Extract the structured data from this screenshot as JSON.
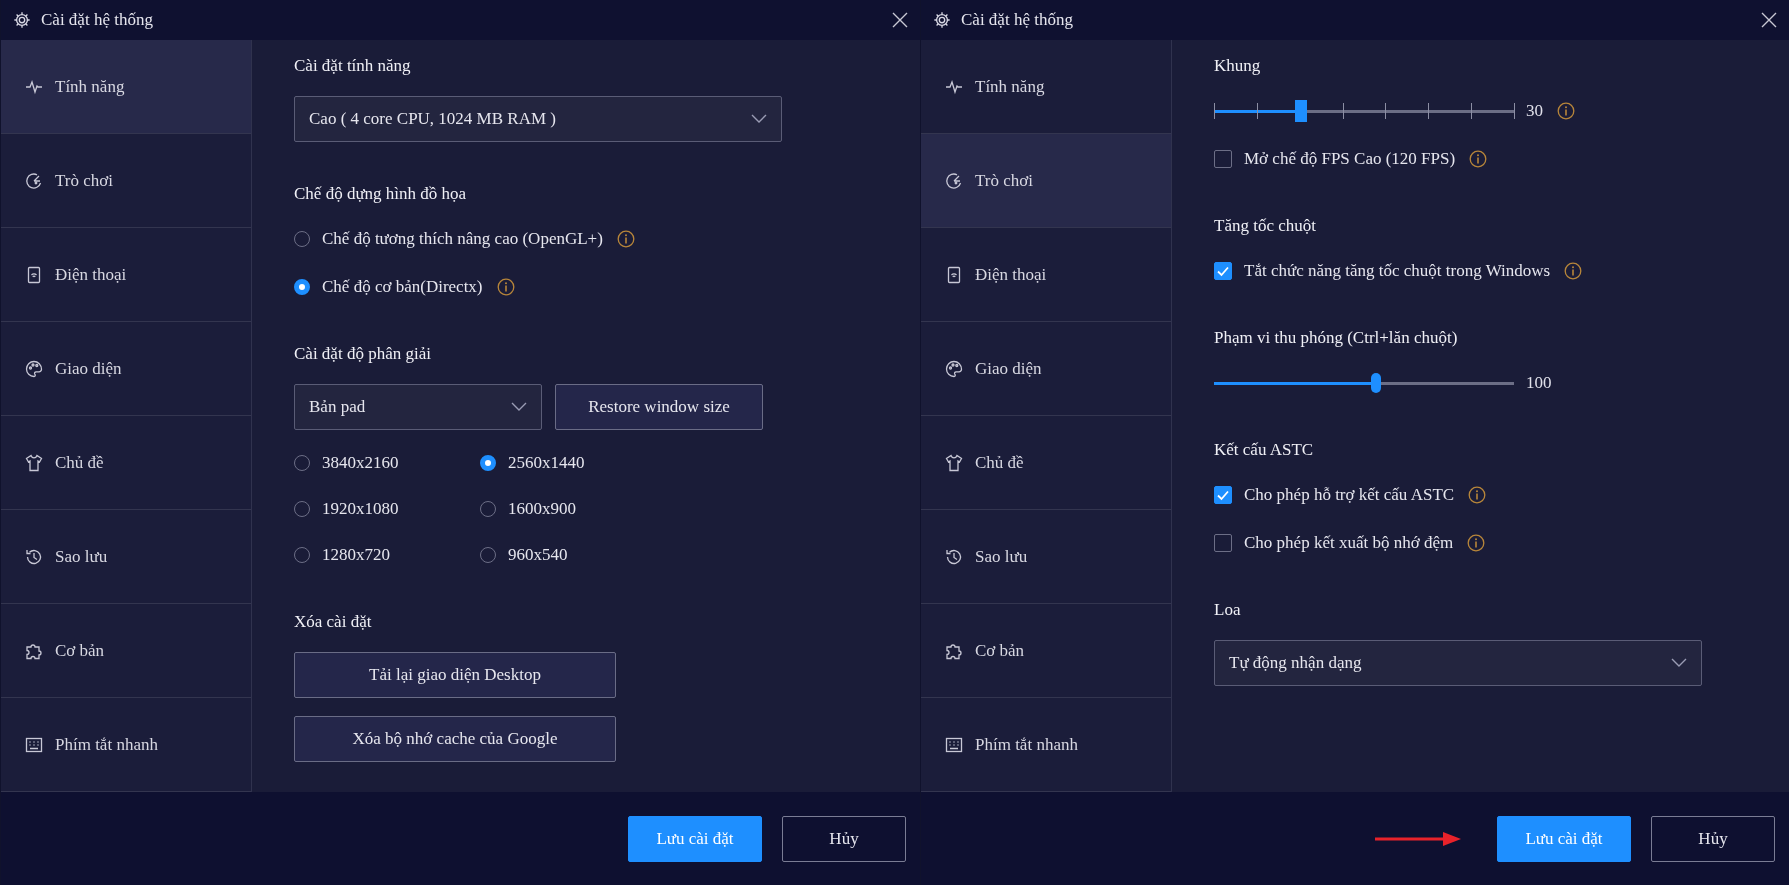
{
  "windows": [
    {
      "title": "Cài đặt hệ thống",
      "sidebar": [
        {
          "label": "Tính năng",
          "selected": true
        },
        {
          "label": "Trò chơi",
          "selected": false
        },
        {
          "label": "Điện thoại",
          "selected": false
        },
        {
          "label": "Giao diện",
          "selected": false
        },
        {
          "label": "Chủ đề",
          "selected": false
        },
        {
          "label": "Sao lưu",
          "selected": false
        },
        {
          "label": "Cơ bản",
          "selected": false
        },
        {
          "label": "Phím tắt nhanh",
          "selected": false
        }
      ],
      "sections": [
        {
          "heading": "Cài đặt tính năng",
          "items": [
            {
              "kind": "dropdown",
              "value": "Cao ( 4 core CPU, 1024 MB RAM )"
            }
          ]
        },
        {
          "heading": "Chế độ dựng hình đồ họa",
          "items": [
            {
              "kind": "radio",
              "label": "Chế độ tương thích nâng cao (OpenGL+)",
              "selected": false,
              "info": true
            },
            {
              "kind": "radio",
              "label": "Chế độ cơ bản(Directx)",
              "selected": true,
              "info": true
            }
          ]
        },
        {
          "heading": "Cài đặt độ phân giải",
          "items": [
            {
              "kind": "dropdown_button",
              "value": "Bản pad",
              "button": "Restore window size"
            },
            {
              "kind": "radio_grid",
              "options": [
                {
                  "label": "3840x2160",
                  "selected": false
                },
                {
                  "label": "2560x1440",
                  "selected": true
                },
                {
                  "label": "1920x1080",
                  "selected": false
                },
                {
                  "label": "1600x900",
                  "selected": false
                },
                {
                  "label": "1280x720",
                  "selected": false
                },
                {
                  "label": "960x540",
                  "selected": false
                }
              ]
            }
          ]
        },
        {
          "heading": "Xóa cài đặt",
          "items": [
            {
              "kind": "button",
              "label": "Tải lại giao diện Desktop"
            },
            {
              "kind": "button",
              "label": "Xóa bộ nhớ cache của Google"
            }
          ]
        }
      ],
      "buttons": [
        {
          "label": "Lưu cài đặt",
          "primary": true
        },
        {
          "label": "Hủy",
          "primary": false
        }
      ],
      "arrow": false
    },
    {
      "title": "Cài đặt hệ thống",
      "sidebar": [
        {
          "label": "Tính năng",
          "selected": false
        },
        {
          "label": "Trò chơi",
          "selected": true
        },
        {
          "label": "Điện thoại",
          "selected": false
        },
        {
          "label": "Giao diện",
          "selected": false
        },
        {
          "label": "Chủ đề",
          "selected": false
        },
        {
          "label": "Sao lưu",
          "selected": false
        },
        {
          "label": "Cơ bản",
          "selected": false
        },
        {
          "label": "Phím tắt nhanh",
          "selected": false
        }
      ],
      "sections": [
        {
          "heading": "Khung",
          "items": [
            {
              "kind": "stepped_slider",
              "level": 0.29,
              "reading": "30",
              "info": true
            },
            {
              "kind": "checkbox",
              "label": "Mở chế độ FPS Cao (120 FPS)",
              "checked": false,
              "info": true
            }
          ]
        },
        {
          "heading": "Tăng tốc chuột",
          "items": [
            {
              "kind": "checkbox",
              "label": "Tắt chức năng tăng tốc chuột trong Windows",
              "checked": true,
              "info": true
            }
          ]
        },
        {
          "heading": "Phạm vi thu phóng (Ctrl+lăn chuột)",
          "items": [
            {
              "kind": "slider",
              "level": 0.54,
              "reading": "100",
              "info": false
            }
          ]
        },
        {
          "heading": "Kết cấu ASTC",
          "items": [
            {
              "kind": "checkbox",
              "label": "Cho phép hỗ trợ kết cấu ASTC",
              "checked": true,
              "info": true
            },
            {
              "kind": "checkbox",
              "label": "Cho phép kết xuất bộ nhớ đệm",
              "checked": false,
              "info": true
            }
          ]
        },
        {
          "heading": "Loa",
          "items": [
            {
              "kind": "dropdown",
              "value": "Tự động nhận dạng"
            }
          ]
        }
      ],
      "buttons": [
        {
          "label": "Lưu cài đặt",
          "primary": true
        },
        {
          "label": "Hủy",
          "primary": false
        }
      ],
      "arrow": true
    }
  ]
}
